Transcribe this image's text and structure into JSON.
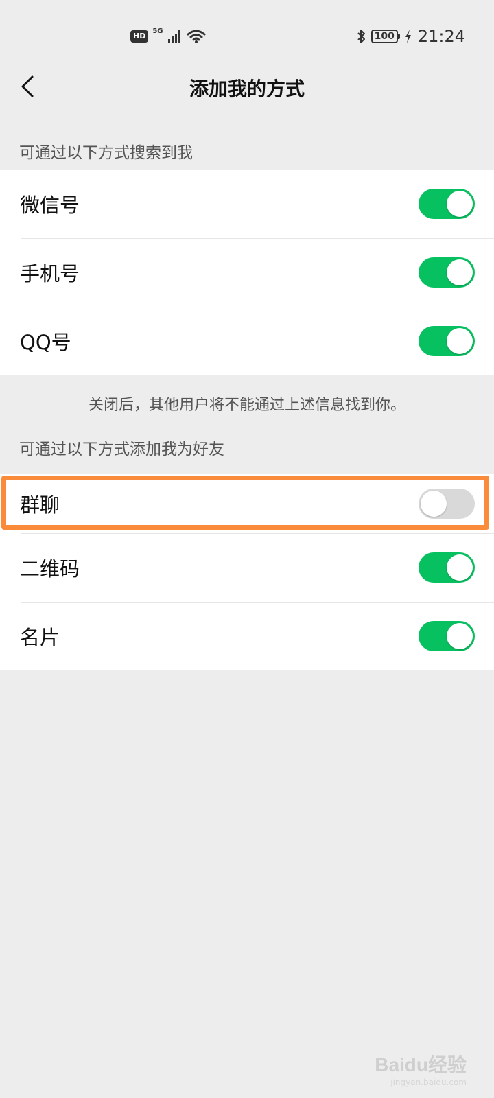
{
  "status_bar": {
    "hd_badge": "HD",
    "network": "5G",
    "battery": "100",
    "time": "21:24",
    "icons": [
      "signal-icon",
      "wifi-icon",
      "bluetooth-icon",
      "charging-icon"
    ]
  },
  "nav": {
    "title": "添加我的方式",
    "back_icon": "chevron-left-icon"
  },
  "search_section": {
    "header": "可通过以下方式搜索到我",
    "items": [
      {
        "label": "微信号",
        "enabled": true
      },
      {
        "label": "手机号",
        "enabled": true
      },
      {
        "label": "QQ号",
        "enabled": true
      }
    ],
    "footer": "关闭后，其他用户将不能通过上述信息找到你。"
  },
  "add_section": {
    "header": "可通过以下方式添加我为好友",
    "items": [
      {
        "label": "群聊",
        "enabled": false
      },
      {
        "label": "二维码",
        "enabled": true
      },
      {
        "label": "名片",
        "enabled": true
      }
    ]
  },
  "colors": {
    "toggle_on": "#07c160",
    "toggle_off": "#d9d9d9",
    "highlight": "#f98b3a",
    "background": "#ededed"
  },
  "watermark": {
    "brand": "Baidu经验",
    "sub": "jingyan.baidu.com"
  }
}
